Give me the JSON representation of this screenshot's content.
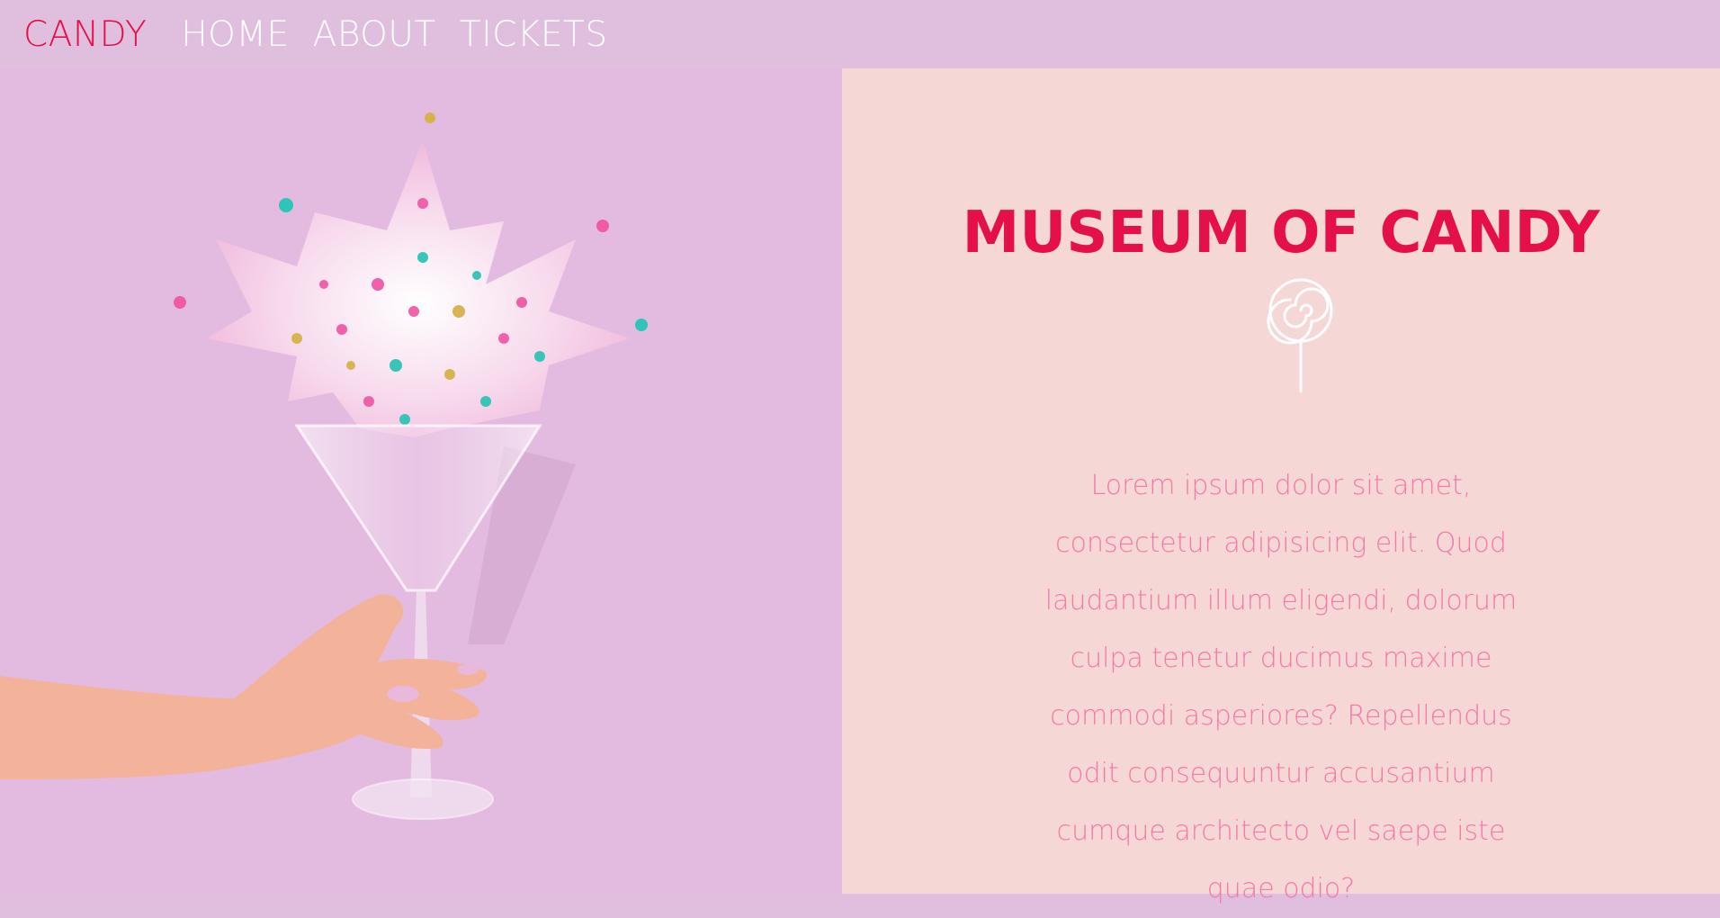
{
  "nav": {
    "brand": "CANDY",
    "links": [
      "HOME",
      "ABOUT",
      "TICKETS"
    ]
  },
  "hero": {
    "image_alt": "Hand holding a martini glass bursting with candy sprinkles"
  },
  "panel": {
    "title": "MUSEUM OF CANDY",
    "icon": "lollipop-icon",
    "body": "Lorem ipsum dolor sit amet, consectetur adipisicing elit. Quod laudantium illum eligendi, dolorum culpa tenetur ducimus maxime commodi asperiores? Repellendus odit consequuntur accusantium cumque architecto vel saepe iste quae odio?"
  },
  "colors": {
    "accent": "#e5104a",
    "nav_bg": "#e0bedd",
    "panel_bg": "#f5d7d5",
    "body_text": "#f47aa9"
  }
}
